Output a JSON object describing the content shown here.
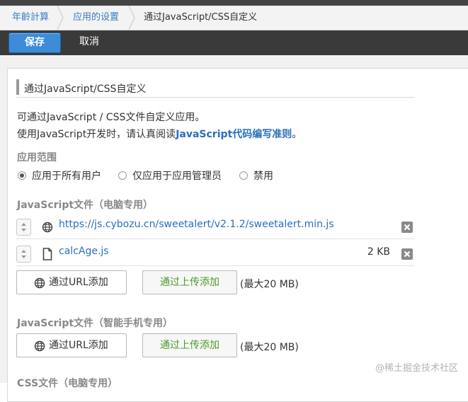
{
  "breadcrumb": {
    "items": [
      "年齡計算",
      "应用的设置",
      "通过JavaScript/CSS自定义"
    ]
  },
  "toolbar": {
    "save_label": "保存",
    "cancel_label": "取消"
  },
  "section": {
    "title": "通过JavaScript/CSS自定义",
    "desc_line1": "可通过JavaScript / CSS文件自定义应用。",
    "desc_line2_prefix": "使用JavaScript开发时，请认真阅读",
    "desc_line2_link": "JavaScript代码编写准则",
    "desc_line2_suffix": "。"
  },
  "scope": {
    "label": "应用范围",
    "options": [
      "应用于所有用户",
      "仅应用于应用管理员",
      "禁用"
    ],
    "selected_index": 0
  },
  "js_pc": {
    "label": "JavaScript文件（电脑专用）",
    "files": [
      {
        "name": "https://js.cybozu.cn/sweetalert/v2.1.2/sweetalert.min.js",
        "size": "",
        "icon": "globe-icon"
      },
      {
        "name": "calcAge.js",
        "size": "2 KB",
        "icon": "file-icon"
      }
    ],
    "add_url_label": "通过URL添加",
    "upload_label": "通过上传添加",
    "max_label": "(最大20 MB)"
  },
  "js_mobile": {
    "label": "JavaScript文件（智能手机专用）",
    "add_url_label": "通过URL添加",
    "upload_label": "通过上传添加",
    "max_label": "(最大20 MB)"
  },
  "css_pc": {
    "label": "CSS文件（电脑专用）"
  },
  "watermark": "@稀土掘金技术社区",
  "colors": {
    "accent": "#3c8cd9",
    "link": "#2a6ebb",
    "upload_text": "#4d9b2a",
    "toolbar_bg": "#3a3a3a"
  }
}
